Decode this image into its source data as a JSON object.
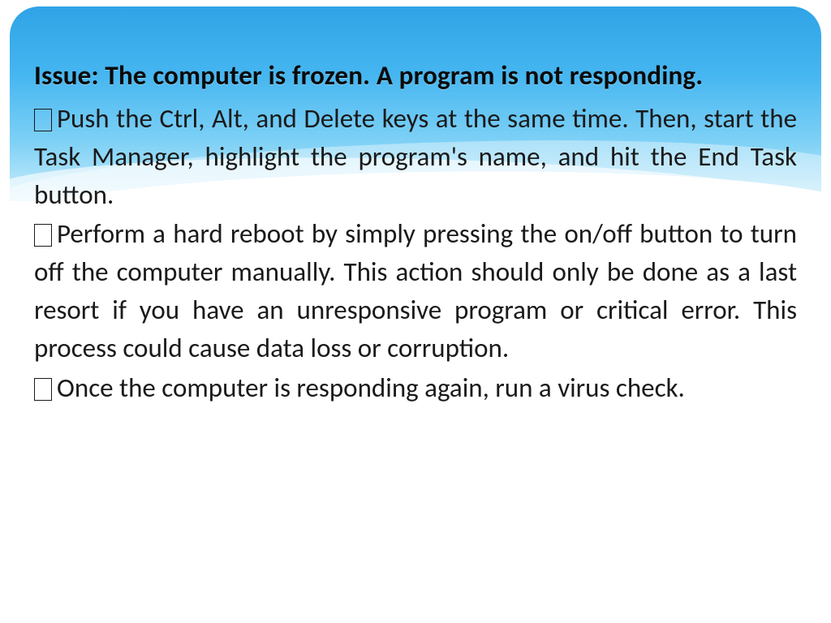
{
  "slide": {
    "heading": "Issue: The computer is frozen. A program is not responding.",
    "bullets": [
      "Push the Ctrl, Alt, and Delete keys at the same time. Then, start the Task Manager, highlight the program's name, and hit the End Task button.",
      "Perform a hard reboot by simply pressing the on/off button to turn off the computer manually. This action should only be done as a last resort if you have an unresponsive program or critical error. This process could cause data loss or corruption.",
      "Once the computer is responding again, run a virus check."
    ]
  }
}
